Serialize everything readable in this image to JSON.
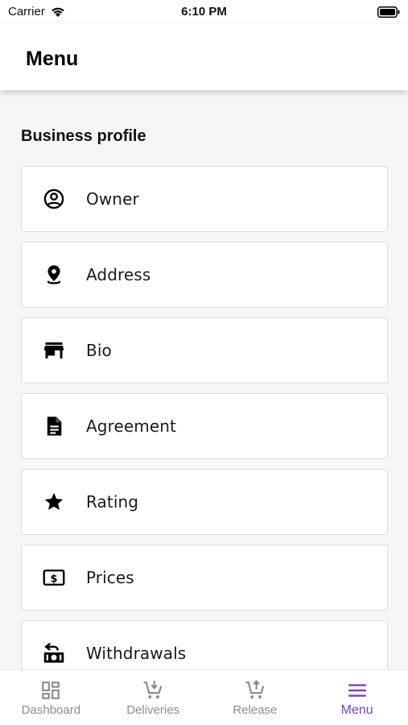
{
  "status_bar": {
    "carrier": "Carrier",
    "time": "6:10 PM"
  },
  "header": {
    "title": "Menu"
  },
  "section": {
    "title": "Business profile"
  },
  "menu_items": [
    {
      "label": "Owner",
      "icon": "account-circle-icon"
    },
    {
      "label": "Address",
      "icon": "location-pin-icon"
    },
    {
      "label": "Bio",
      "icon": "storefront-icon"
    },
    {
      "label": "Agreement",
      "icon": "document-icon"
    },
    {
      "label": "Rating",
      "icon": "star-icon"
    },
    {
      "label": "Prices",
      "icon": "dollar-bill-icon"
    },
    {
      "label": "Withdrawals",
      "icon": "cash-exchange-icon"
    }
  ],
  "bottom_nav": {
    "tabs": [
      {
        "label": "Dashboard",
        "icon": "dashboard-icon"
      },
      {
        "label": "Deliveries",
        "icon": "cart-down-icon"
      },
      {
        "label": "Release",
        "icon": "cart-up-icon"
      },
      {
        "label": "Menu",
        "icon": "hamburger-menu-icon",
        "active": true
      }
    ]
  },
  "colors": {
    "accent": "#7b3fc2",
    "inactive": "#8c8c8c",
    "background": "#f6f6f6"
  }
}
